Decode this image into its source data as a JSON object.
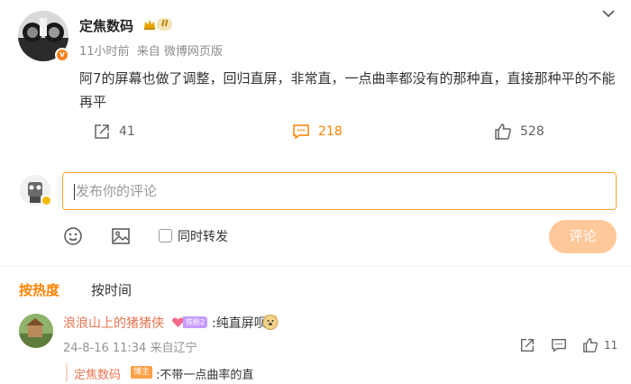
{
  "post": {
    "author": "定焦数码",
    "level_badge": "II",
    "verified_badge": "v",
    "time": "11小时前",
    "source": "来自 微博网页版",
    "content": "阿7的屏幕也做了调整，回归直屏，非常直，一点曲率都没有的那种直，直接那种平的不能再平",
    "reposts": "41",
    "comments": "218",
    "likes": "528",
    "accent_color": "#ff8200"
  },
  "composer": {
    "placeholder": "发布你的评论",
    "repost_label": "同时转发",
    "submit_label": "评论",
    "icons": [
      "emoji-icon",
      "image-icon"
    ]
  },
  "sort_tabs": {
    "hot": "按热度",
    "time": "按时间"
  },
  "comment": {
    "user": "浪浪山上的猪猪侠",
    "fan_badge": "铁粉2",
    "text": ":纯直屏呗",
    "emoji": "doge-emoji",
    "date": "24-8-16 11:34",
    "location": "来自辽宁",
    "likes": "11",
    "reply": {
      "user": "定焦数码",
      "badge": "博主",
      "text": ":不带一点曲率的直"
    }
  }
}
